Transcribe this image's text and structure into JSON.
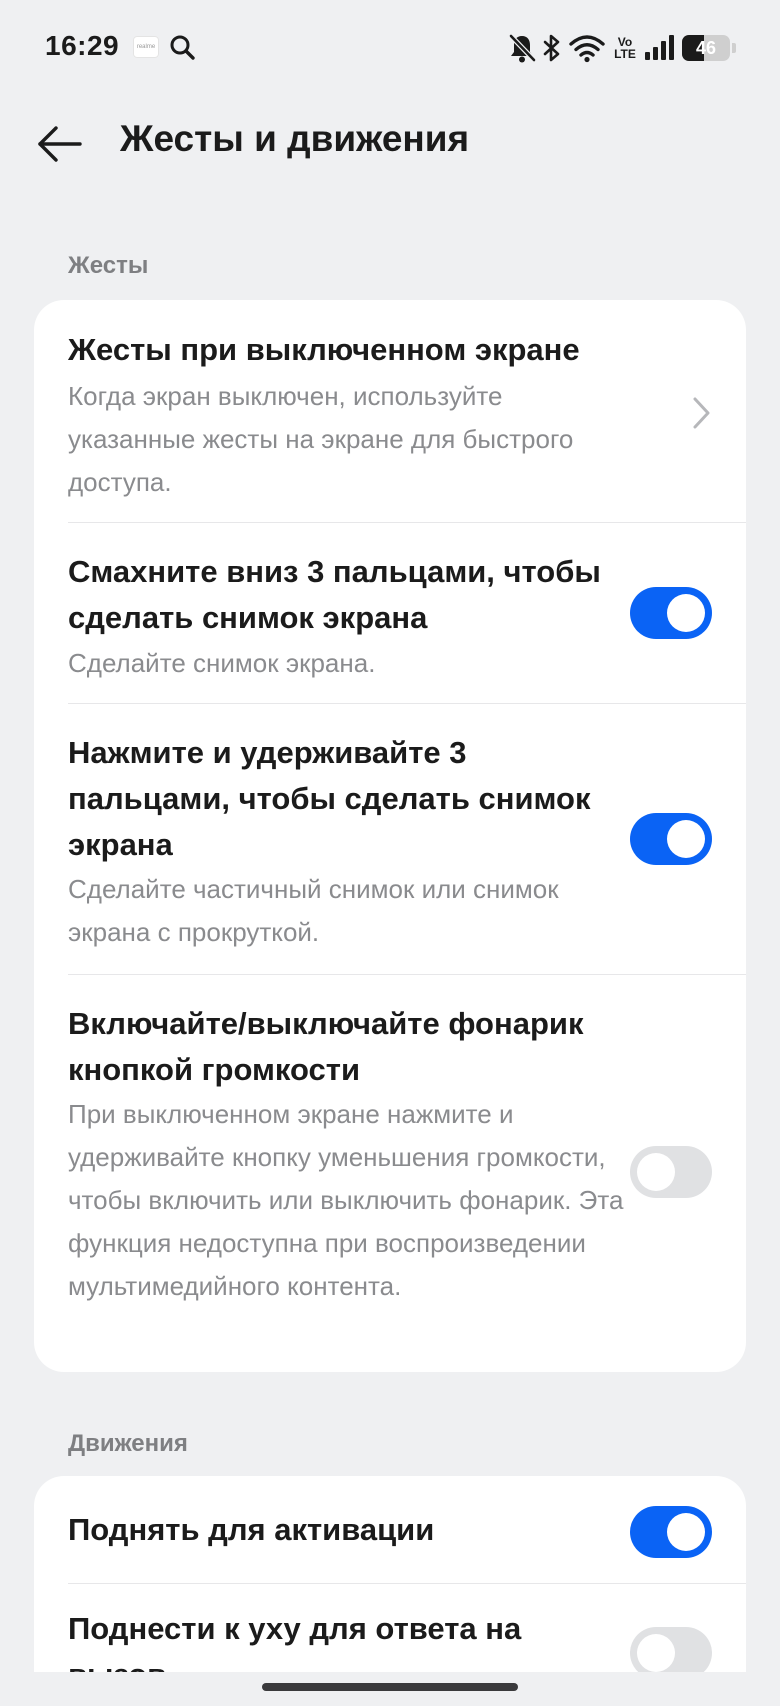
{
  "status_bar": {
    "time": "16:29",
    "app_badge": "realme",
    "volte_top": "Vo",
    "volte_bottom": "LTE",
    "battery_level": "46",
    "battery_fraction": 0.46
  },
  "header": {
    "title": "Жесты и движения"
  },
  "sections": [
    {
      "title": "Жесты",
      "items": [
        {
          "title": "Жесты при выключенном экране",
          "subtitle": "Когда экран выключен, используйте указанные жесты на экране для быстрого доступа.",
          "control": "chevron"
        },
        {
          "title": "Смахните вниз 3 пальцами, чтобы сделать снимок экрана",
          "subtitle": "Сделайте снимок экрана.",
          "control": "toggle",
          "on": true
        },
        {
          "title": "Нажмите и удерживайте 3 пальцами, чтобы сделать снимок экрана",
          "subtitle": "Сделайте частичный снимок или снимок экрана с прокруткой.",
          "control": "toggle",
          "on": true
        },
        {
          "title": "Включайте/выключайте фонарик кнопкой громкости",
          "subtitle": "При выключенном экране нажмите и удерживайте кнопку уменьшения громкости, чтобы включить или выключить фонарик. Эта функция недоступна при воспроизведении мультимедийного контента.",
          "control": "toggle",
          "on": false
        }
      ]
    },
    {
      "title": "Движения",
      "items": [
        {
          "title": "Поднять для активации",
          "control": "toggle",
          "on": true
        },
        {
          "title": "Поднести к уху для ответа на вызов",
          "control": "toggle",
          "on": false
        }
      ]
    }
  ],
  "colors": {
    "accent": "#0a63f5",
    "toggle_off": "#e0e1e3",
    "background": "#eff0f2",
    "card": "#ffffff",
    "subtitle": "#8a8b8e"
  }
}
